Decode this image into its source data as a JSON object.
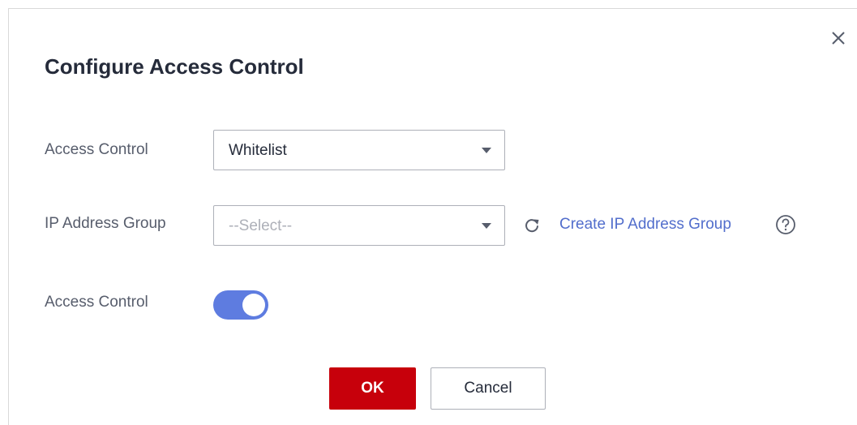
{
  "dialog": {
    "title": "Configure Access Control",
    "close_icon": "close-icon"
  },
  "form": {
    "access_control_type": {
      "label": "Access Control",
      "value": "Whitelist"
    },
    "ip_address_group": {
      "label": "IP Address Group",
      "placeholder": "--Select--",
      "refresh_icon": "refresh-icon",
      "create_link": "Create IP Address Group",
      "help_icon": "help-icon"
    },
    "access_control_switch": {
      "label": "Access Control",
      "enabled": true
    }
  },
  "footer": {
    "ok_label": "OK",
    "cancel_label": "Cancel"
  },
  "colors": {
    "primary_button": "#c7000b",
    "link": "#526ecc",
    "toggle_on": "#5e7ce0"
  }
}
